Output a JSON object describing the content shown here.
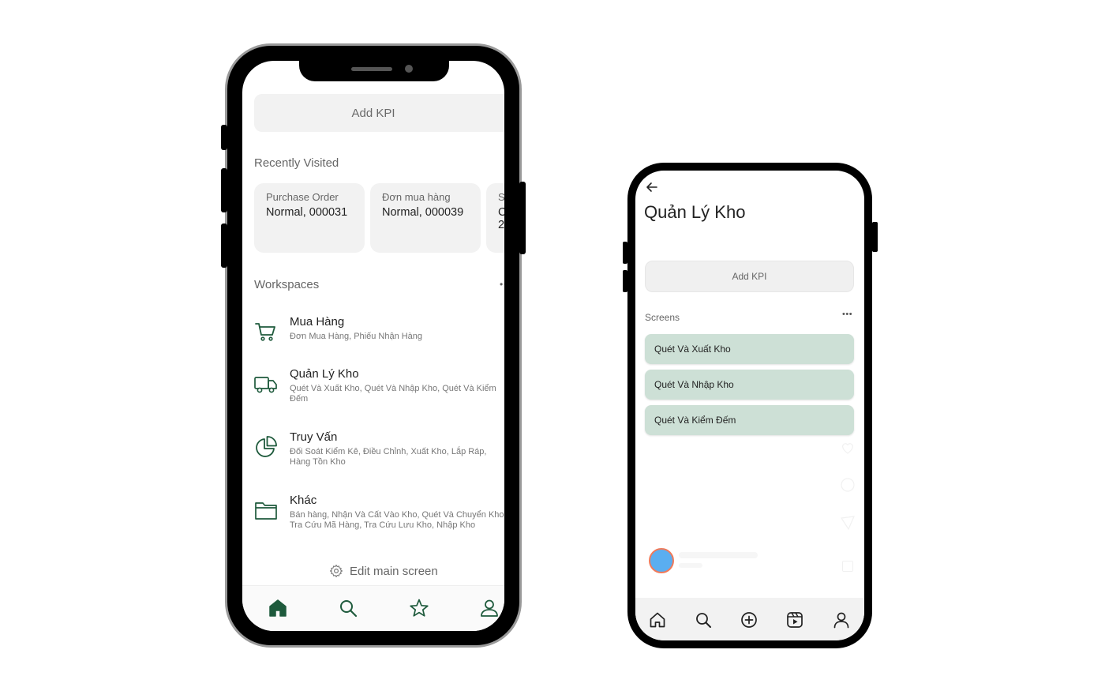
{
  "phone1": {
    "add_kpi_label": "Add KPI",
    "recently_visited_title": "Recently Visited",
    "recent_cards": [
      {
        "title": "Purchase Order",
        "line1": "Normal, 000031",
        "line2": ""
      },
      {
        "title": "Đơn mua hàng",
        "line1": "Normal, 000039",
        "line2": ""
      },
      {
        "title": "S",
        "line1": "C",
        "line2": "2"
      }
    ],
    "workspaces_title": "Workspaces",
    "workspaces_more": "••",
    "workspaces": [
      {
        "icon": "cart-icon",
        "name": "Mua Hàng",
        "desc": "Đơn Mua Hàng, Phiếu Nhận Hàng"
      },
      {
        "icon": "truck-icon",
        "name": "Quản Lý Kho",
        "desc": "Quét Và Xuất Kho, Quét Và Nhập Kho, Quét Và Kiểm Đếm"
      },
      {
        "icon": "pie-chart-icon",
        "name": "Truy Vấn",
        "desc": "Đối Soát Kiểm Kê, Điều Chỉnh, Xuất Kho, Lắp Ráp, Hàng Tồn Kho"
      },
      {
        "icon": "folder-icon",
        "name": "Khác",
        "desc": "Bán hàng, Nhận Và Cất Vào Kho, Quét Và Chuyển Kho, Tra Cứu Mã Hàng, Tra Cứu Lưu Kho, Nhập Kho"
      }
    ],
    "edit_main_label": "Edit main screen",
    "nav": [
      "home-icon",
      "search-icon",
      "star-icon",
      "user-icon"
    ],
    "accent_color": "#1e5a3c"
  },
  "phone2": {
    "title": "Quản Lý Kho",
    "add_kpi_label": "Add KPI",
    "screens_title": "Screens",
    "screens_more": "•••",
    "screens": [
      "Quét Và Xuất Kho",
      "Quét Và Nhập Kho",
      "Quét Và Kiểm Đếm"
    ],
    "nav": [
      "home-icon",
      "search-icon",
      "add-circle-icon",
      "reels-icon",
      "user-icon"
    ],
    "item_color": "#cde0d6"
  }
}
